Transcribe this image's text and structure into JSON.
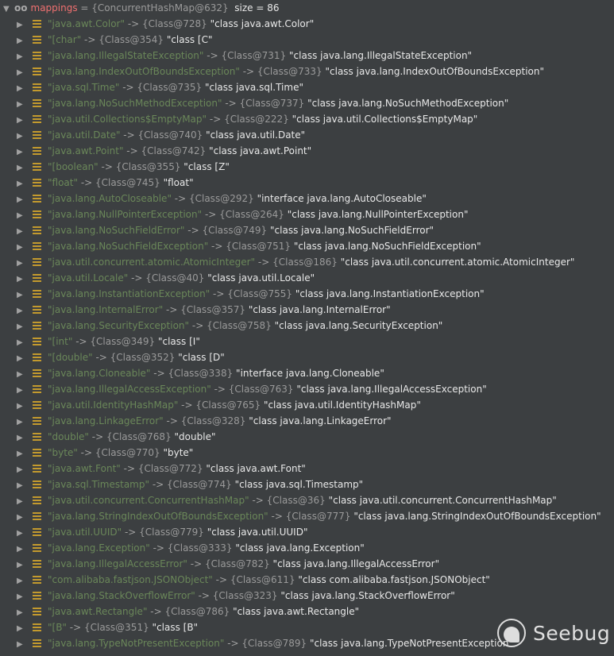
{
  "header": {
    "name": "mappings",
    "eq": " = ",
    "ref": "{ConcurrentHashMap@632}",
    "size": "  size = 86"
  },
  "arrow": " -> ",
  "entries": [
    [
      "\"java.awt.Color\"",
      "{Class@728}",
      "\"class java.awt.Color\""
    ],
    [
      "\"[char\"",
      "{Class@354}",
      "\"class [C\""
    ],
    [
      "\"java.lang.IllegalStateException\"",
      "{Class@731}",
      "\"class java.lang.IllegalStateException\""
    ],
    [
      "\"java.lang.IndexOutOfBoundsException\"",
      "{Class@733}",
      "\"class java.lang.IndexOutOfBoundsException\""
    ],
    [
      "\"java.sql.Time\"",
      "{Class@735}",
      "\"class java.sql.Time\""
    ],
    [
      "\"java.lang.NoSuchMethodException\"",
      "{Class@737}",
      "\"class java.lang.NoSuchMethodException\""
    ],
    [
      "\"java.util.Collections$EmptyMap\"",
      "{Class@222}",
      "\"class java.util.Collections$EmptyMap\""
    ],
    [
      "\"java.util.Date\"",
      "{Class@740}",
      "\"class java.util.Date\""
    ],
    [
      "\"java.awt.Point\"",
      "{Class@742}",
      "\"class java.awt.Point\""
    ],
    [
      "\"[boolean\"",
      "{Class@355}",
      "\"class [Z\""
    ],
    [
      "\"float\"",
      "{Class@745}",
      "\"float\""
    ],
    [
      "\"java.lang.AutoCloseable\"",
      "{Class@292}",
      "\"interface java.lang.AutoCloseable\""
    ],
    [
      "\"java.lang.NullPointerException\"",
      "{Class@264}",
      "\"class java.lang.NullPointerException\""
    ],
    [
      "\"java.lang.NoSuchFieldError\"",
      "{Class@749}",
      "\"class java.lang.NoSuchFieldError\""
    ],
    [
      "\"java.lang.NoSuchFieldException\"",
      "{Class@751}",
      "\"class java.lang.NoSuchFieldException\""
    ],
    [
      "\"java.util.concurrent.atomic.AtomicInteger\"",
      "{Class@186}",
      "\"class java.util.concurrent.atomic.AtomicInteger\""
    ],
    [
      "\"java.util.Locale\"",
      "{Class@40}",
      "\"class java.util.Locale\""
    ],
    [
      "\"java.lang.InstantiationException\"",
      "{Class@755}",
      "\"class java.lang.InstantiationException\""
    ],
    [
      "\"java.lang.InternalError\"",
      "{Class@357}",
      "\"class java.lang.InternalError\""
    ],
    [
      "\"java.lang.SecurityException\"",
      "{Class@758}",
      "\"class java.lang.SecurityException\""
    ],
    [
      "\"[int\"",
      "{Class@349}",
      "\"class [I\""
    ],
    [
      "\"[double\"",
      "{Class@352}",
      "\"class [D\""
    ],
    [
      "\"java.lang.Cloneable\"",
      "{Class@338}",
      "\"interface java.lang.Cloneable\""
    ],
    [
      "\"java.lang.IllegalAccessException\"",
      "{Class@763}",
      "\"class java.lang.IllegalAccessException\""
    ],
    [
      "\"java.util.IdentityHashMap\"",
      "{Class@765}",
      "\"class java.util.IdentityHashMap\""
    ],
    [
      "\"java.lang.LinkageError\"",
      "{Class@328}",
      "\"class java.lang.LinkageError\""
    ],
    [
      "\"double\"",
      "{Class@768}",
      "\"double\""
    ],
    [
      "\"byte\"",
      "{Class@770}",
      "\"byte\""
    ],
    [
      "\"java.awt.Font\"",
      "{Class@772}",
      "\"class java.awt.Font\""
    ],
    [
      "\"java.sql.Timestamp\"",
      "{Class@774}",
      "\"class java.sql.Timestamp\""
    ],
    [
      "\"java.util.concurrent.ConcurrentHashMap\"",
      "{Class@36}",
      "\"class java.util.concurrent.ConcurrentHashMap\""
    ],
    [
      "\"java.lang.StringIndexOutOfBoundsException\"",
      "{Class@777}",
      "\"class java.lang.StringIndexOutOfBoundsException\""
    ],
    [
      "\"java.util.UUID\"",
      "{Class@779}",
      "\"class java.util.UUID\""
    ],
    [
      "\"java.lang.Exception\"",
      "{Class@333}",
      "\"class java.lang.Exception\""
    ],
    [
      "\"java.lang.IllegalAccessError\"",
      "{Class@782}",
      "\"class java.lang.IllegalAccessError\""
    ],
    [
      "\"com.alibaba.fastjson.JSONObject\"",
      "{Class@611}",
      "\"class com.alibaba.fastjson.JSONObject\""
    ],
    [
      "\"java.lang.StackOverflowError\"",
      "{Class@323}",
      "\"class java.lang.StackOverflowError\""
    ],
    [
      "\"java.awt.Rectangle\"",
      "{Class@786}",
      "\"class java.awt.Rectangle\""
    ],
    [
      "\"[B\"",
      "{Class@351}",
      "\"class [B\""
    ],
    [
      "\"java.lang.TypeNotPresentException\"",
      "{Class@789}",
      "\"class java.lang.TypeNotPresentException\""
    ]
  ],
  "watermark": "Seebug"
}
